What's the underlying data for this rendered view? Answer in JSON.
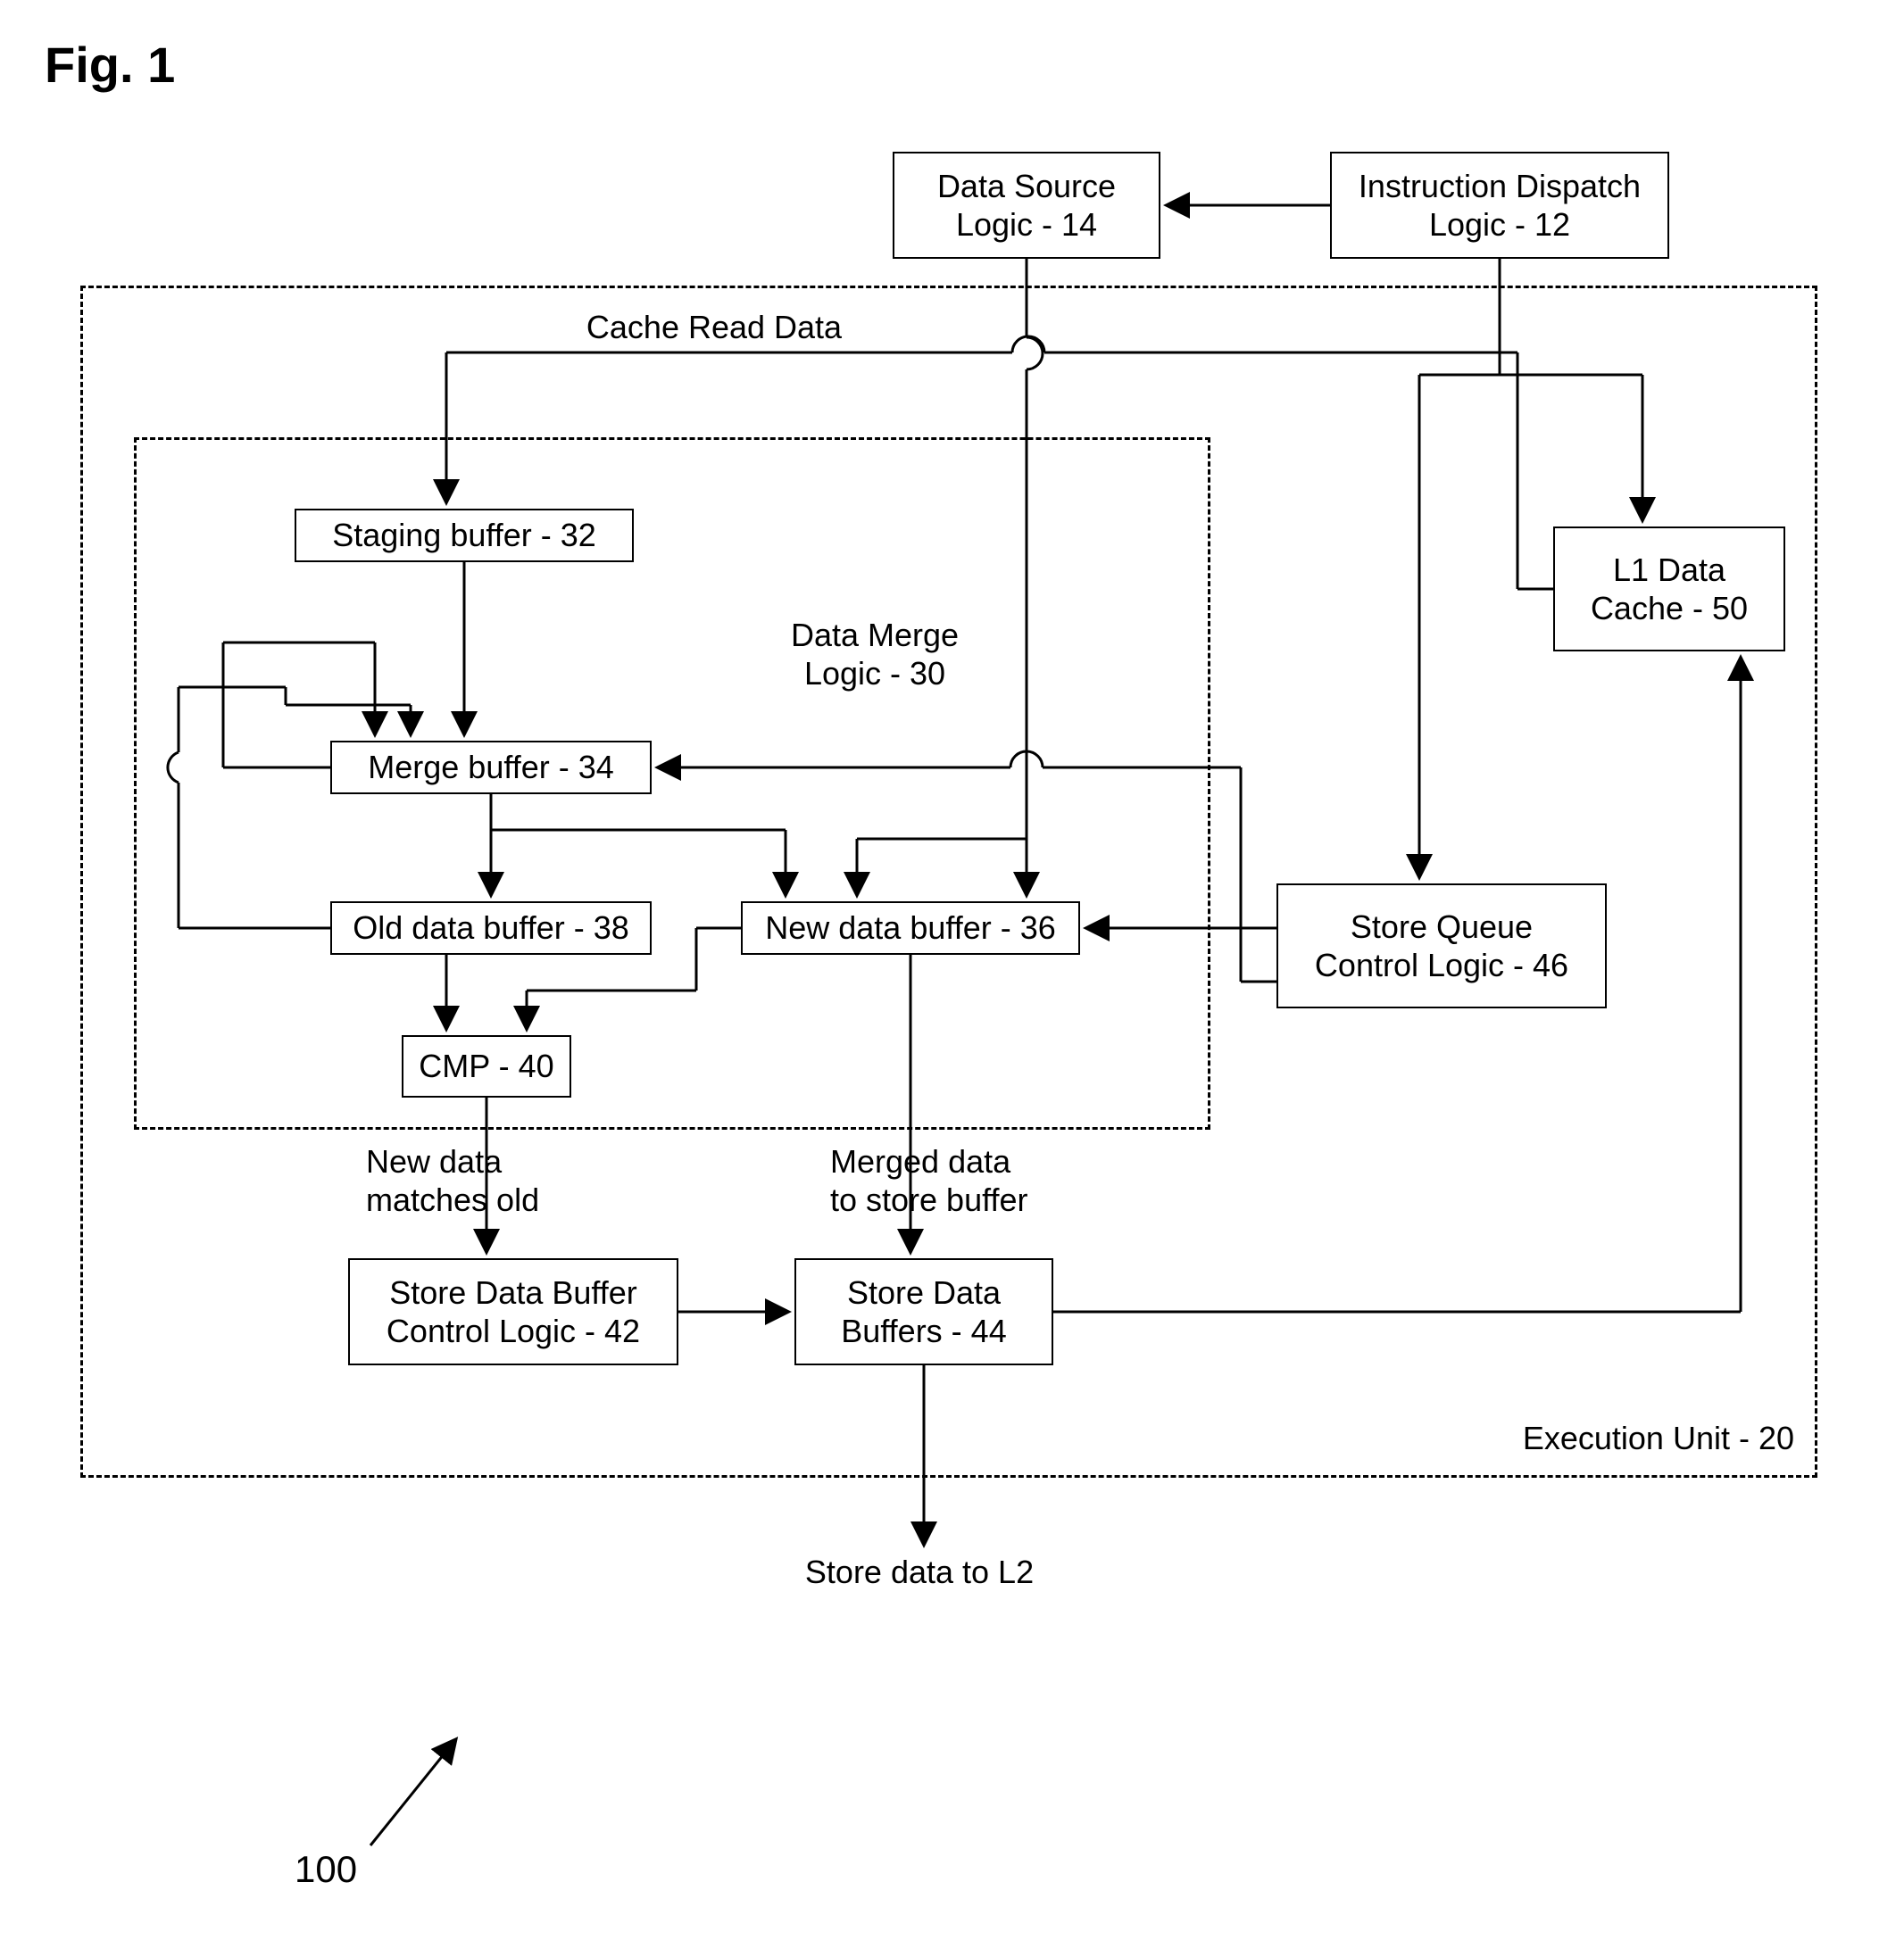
{
  "figure_title": "Fig. 1",
  "reference_number": "100",
  "top": {
    "data_source": "Data Source\nLogic - 14",
    "instruction_dispatch": "Instruction Dispatch\nLogic - 12"
  },
  "execution_unit_label": "Execution Unit - 20",
  "cache_read_data_label": "Cache Read Data",
  "data_merge": {
    "label": "Data Merge\nLogic - 30",
    "staging_buffer": "Staging buffer - 32",
    "merge_buffer": "Merge buffer - 34",
    "old_data_buffer": "Old data buffer - 38",
    "new_data_buffer": "New data buffer - 36",
    "cmp": "CMP - 40"
  },
  "right": {
    "l1_cache": "L1 Data\nCache - 50",
    "store_queue": "Store Queue\nControl Logic - 46"
  },
  "bottom": {
    "edge_label_left": "New data\nmatches old",
    "edge_label_right": "Merged data\nto store buffer",
    "store_data_ctrl": "Store Data Buffer\nControl Logic - 42",
    "store_data_buffers": "Store Data\nBuffers - 44",
    "store_to_l2": "Store data to L2"
  }
}
